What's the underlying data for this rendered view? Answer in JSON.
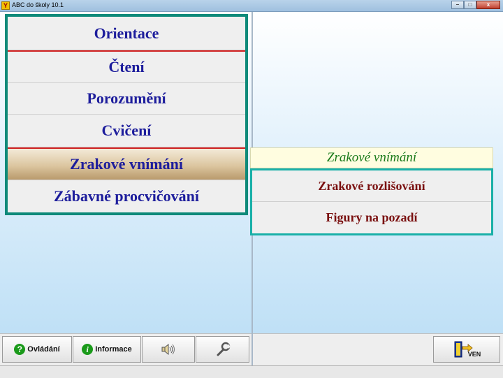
{
  "window": {
    "title": "ABC do školy 10.1",
    "buttons": {
      "minimize": "–",
      "maximize": "□",
      "close": "x"
    }
  },
  "menu": {
    "items": [
      {
        "label": "Orientace",
        "active": false
      },
      {
        "label": "Čtení",
        "active": false
      },
      {
        "label": "Porozumění",
        "active": false
      },
      {
        "label": "Cvičení",
        "active": false
      },
      {
        "label": "Zrakové vnímání",
        "active": true
      },
      {
        "label": "Zábavné procvičování",
        "active": false
      }
    ]
  },
  "submenu": {
    "title": "Zrakové vnímání",
    "items": [
      {
        "label": "Zrakové rozlišování"
      },
      {
        "label": "Figury na pozadí"
      }
    ]
  },
  "toolbar": {
    "controls_label": "Ovládání",
    "info_label": "Informace",
    "sound_icon": "speaker-icon",
    "settings_icon": "wrench-icon",
    "exit_label": "VEN"
  },
  "colors": {
    "menu_border": "#0f8a7a",
    "menu_text": "#1d1d9c",
    "submenu_border": "#19b0a8",
    "submenu_text": "#7a1010",
    "submenu_title": "#1a7a1a",
    "separator": "#d02020"
  }
}
